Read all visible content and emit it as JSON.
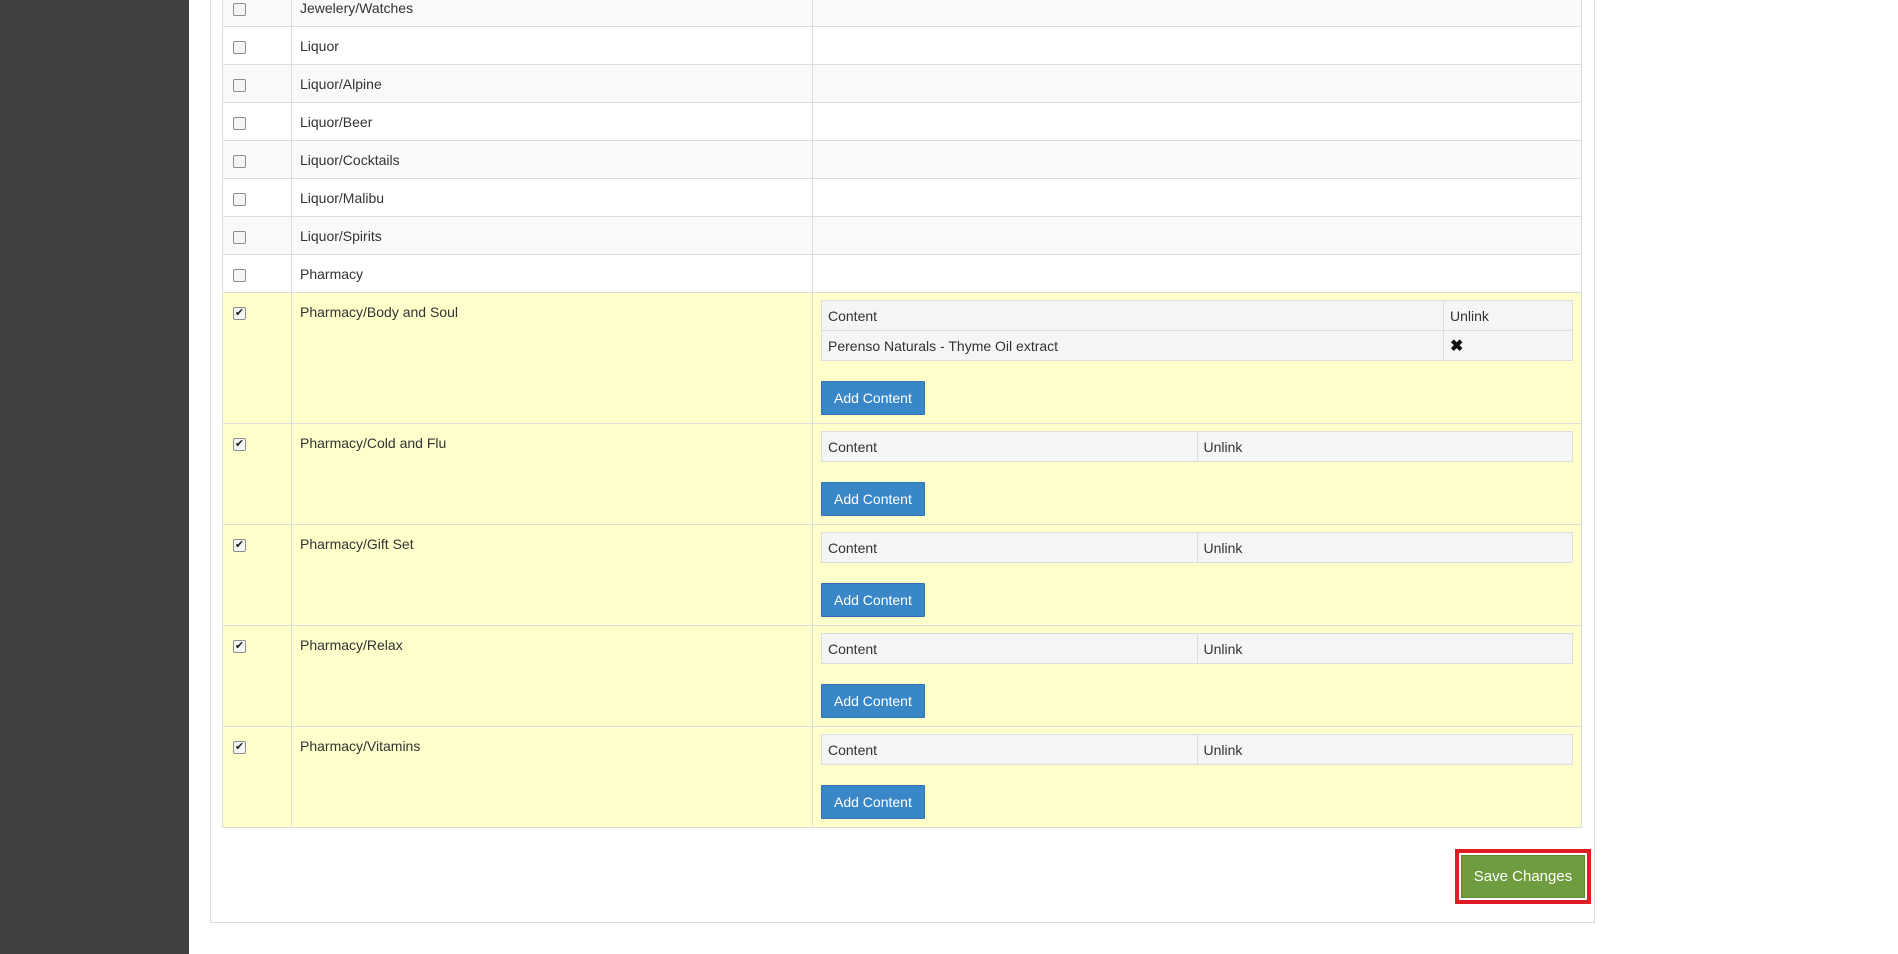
{
  "categories": [
    {
      "name": "Jewelery/Watches",
      "checked": false
    },
    {
      "name": "Liquor",
      "checked": false
    },
    {
      "name": "Liquor/Alpine",
      "checked": false
    },
    {
      "name": "Liquor/Beer",
      "checked": false
    },
    {
      "name": "Liquor/Cocktails",
      "checked": false
    },
    {
      "name": "Liquor/Malibu",
      "checked": false
    },
    {
      "name": "Liquor/Spirits",
      "checked": false
    },
    {
      "name": "Pharmacy",
      "checked": false
    },
    {
      "name": "Pharmacy/Body and Soul",
      "checked": true,
      "content_header": "Content",
      "unlink_header": "Unlink",
      "items": [
        {
          "content": "Perenso Naturals - Thyme Oil extract",
          "unlink": "✖"
        }
      ],
      "add_label": "Add Content"
    },
    {
      "name": "Pharmacy/Cold and Flu",
      "checked": true,
      "content_header": "Content",
      "unlink_header": "Unlink",
      "items": [],
      "add_label": "Add Content"
    },
    {
      "name": "Pharmacy/Gift Set",
      "checked": true,
      "content_header": "Content",
      "unlink_header": "Unlink",
      "items": [],
      "add_label": "Add Content"
    },
    {
      "name": "Pharmacy/Relax",
      "checked": true,
      "content_header": "Content",
      "unlink_header": "Unlink",
      "items": [],
      "add_label": "Add Content"
    },
    {
      "name": "Pharmacy/Vitamins",
      "checked": true,
      "content_header": "Content",
      "unlink_header": "Unlink",
      "items": [],
      "add_label": "Add Content"
    }
  ],
  "checkbox_mark": "✔",
  "save_label": "Save Changes",
  "colors": {
    "sidebar": "#404040",
    "selected_row": "#ffffcc",
    "add_button": "#3a87c8",
    "save_button": "#6e9c3e",
    "highlight": "#e01b24"
  }
}
